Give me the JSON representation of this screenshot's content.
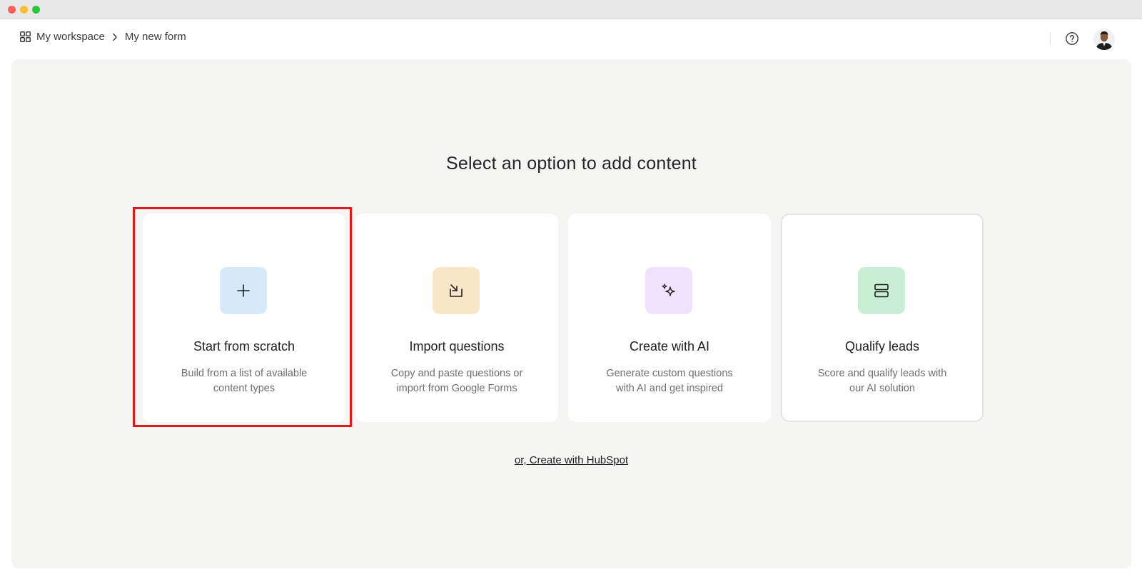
{
  "window": {
    "controls": [
      "close",
      "minimize",
      "maximize"
    ]
  },
  "header": {
    "breadcrumb": {
      "workspace_icon": "grid-icon",
      "workspace": "My workspace",
      "separator_icon": "chevron-right-icon",
      "form": "My new form"
    },
    "help_icon": "help-circle-icon",
    "avatar_icon": "user-avatar"
  },
  "main": {
    "title": "Select an option to add content",
    "options": [
      {
        "title": "Start from scratch",
        "description": "Build from a list of available content types",
        "icon": "plus-icon",
        "icon_bg": "#d6e9fb",
        "highlighted": true
      },
      {
        "title": "Import questions",
        "description": "Copy and paste questions or import from Google Forms",
        "icon": "import-arrow-icon",
        "icon_bg": "#f8e6c6"
      },
      {
        "title": "Create with AI",
        "description": "Generate custom questions with AI and get inspired",
        "icon": "sparkle-icon",
        "icon_bg": "#f0e2fb"
      },
      {
        "title": "Qualify leads",
        "description": "Score and qualify leads with our AI solution",
        "icon": "stacked-rows-icon",
        "icon_bg": "#c8efd4"
      }
    ],
    "hubspot_link": "or, Create with HubSpot"
  },
  "colors": {
    "highlight": "#e11919",
    "panel_bg": "#f5f5f3",
    "titlebar_bg": "#e8e8e8"
  }
}
